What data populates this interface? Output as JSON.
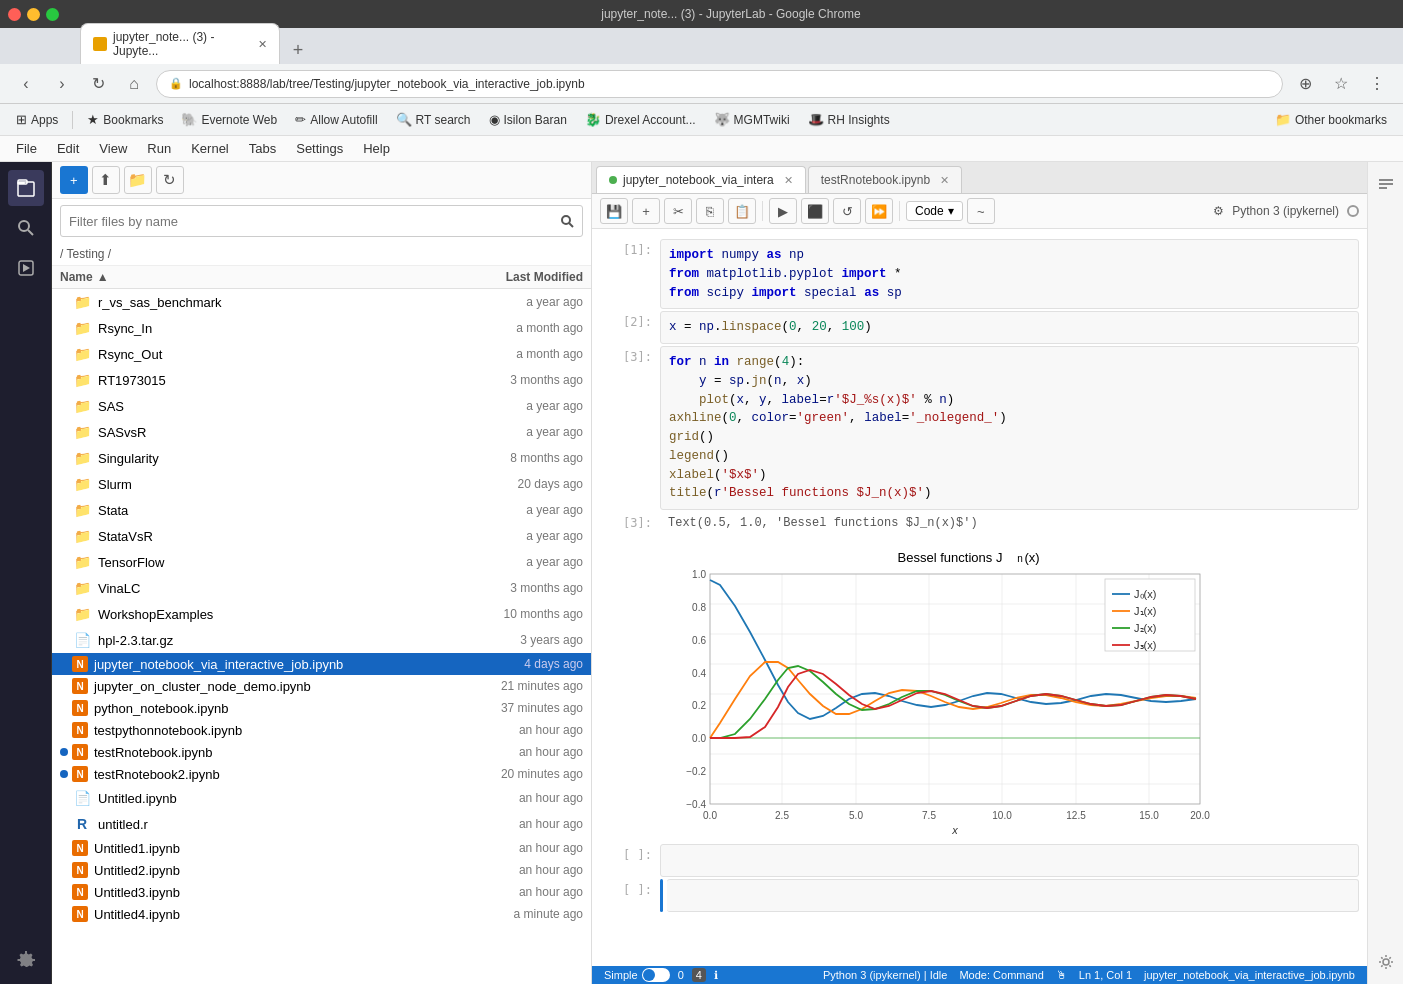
{
  "browser": {
    "title": "jupyter_note... (3) - JupyterLab - Google Chrome",
    "tab_label": "jupyter_note... (3) - Jupyte...",
    "url": "localhost:8888/lab/tree/Testing/jupyter_notebook_via_interactive_job.ipynb"
  },
  "bookmarks": {
    "items": [
      {
        "label": "Apps",
        "icon": "grid"
      },
      {
        "label": "Bookmarks",
        "icon": "star"
      },
      {
        "label": "Evernote Web",
        "icon": "evernote"
      },
      {
        "label": "Allow Autofill",
        "icon": "autofill"
      },
      {
        "label": "RT search",
        "icon": "rt"
      },
      {
        "label": "Isilon Baran",
        "icon": "isilon"
      },
      {
        "label": "Drexel Account...",
        "icon": "drexel"
      },
      {
        "label": "MGMTwiki",
        "icon": "wiki"
      },
      {
        "label": "RH Insights",
        "icon": "rh"
      },
      {
        "label": "Other bookmarks",
        "icon": "folder"
      }
    ]
  },
  "jupyterlab": {
    "menubar": [
      "File",
      "Edit",
      "View",
      "Run",
      "Kernel",
      "Tabs",
      "Settings",
      "Help"
    ],
    "sidebar_icons": [
      "files",
      "search",
      "running",
      "extensions"
    ],
    "file_browser": {
      "toolbar": {
        "new_btn": "+",
        "upload_btn": "↑",
        "refresh_btn": "↻"
      },
      "search_placeholder": "Filter files by name",
      "breadcrumb": "/ Testing /",
      "columns": [
        "Name",
        "Last Modified"
      ],
      "files": [
        {
          "type": "folder",
          "name": "r_vs_sas_benchmark",
          "modified": "a year ago",
          "dot": false
        },
        {
          "type": "folder",
          "name": "Rsync_In",
          "modified": "a month ago",
          "dot": false
        },
        {
          "type": "folder",
          "name": "Rsync_Out",
          "modified": "a month ago",
          "dot": false
        },
        {
          "type": "folder",
          "name": "RT1973015",
          "modified": "3 months ago",
          "dot": false
        },
        {
          "type": "folder",
          "name": "SAS",
          "modified": "a year ago",
          "dot": false
        },
        {
          "type": "folder",
          "name": "SASvsR",
          "modified": "a year ago",
          "dot": false
        },
        {
          "type": "folder",
          "name": "Singularity",
          "modified": "8 months ago",
          "dot": false
        },
        {
          "type": "folder",
          "name": "Slurm",
          "modified": "20 days ago",
          "dot": false
        },
        {
          "type": "folder",
          "name": "Stata",
          "modified": "a year ago",
          "dot": false
        },
        {
          "type": "folder",
          "name": "StataVsR",
          "modified": "a year ago",
          "dot": false
        },
        {
          "type": "folder",
          "name": "TensorFlow",
          "modified": "a year ago",
          "dot": false
        },
        {
          "type": "folder",
          "name": "VinaLC",
          "modified": "3 months ago",
          "dot": false
        },
        {
          "type": "folder",
          "name": "WorkshopExamples",
          "modified": "10 months ago",
          "dot": false
        },
        {
          "type": "file",
          "name": "hpl-2.3.tar.gz",
          "modified": "3 years ago",
          "dot": false
        },
        {
          "type": "notebook",
          "name": "jupyter_notebook_via_interactive_job.ipynb",
          "modified": "4 days ago",
          "dot": false,
          "selected": true
        },
        {
          "type": "notebook",
          "name": "jupyter_on_cluster_node_demo.ipynb",
          "modified": "21 minutes ago",
          "dot": false
        },
        {
          "type": "notebook",
          "name": "python_notebook.ipynb",
          "modified": "37 minutes ago",
          "dot": false
        },
        {
          "type": "notebook",
          "name": "testpythonnotebook.ipynb",
          "modified": "an hour ago",
          "dot": false
        },
        {
          "type": "notebook",
          "name": "testRnotebook.ipynb",
          "modified": "an hour ago",
          "dot": true
        },
        {
          "type": "notebook",
          "name": "testRnotebook2.ipynb",
          "modified": "20 minutes ago",
          "dot": true
        },
        {
          "type": "file",
          "name": "Untitled.ipynb",
          "modified": "an hour ago",
          "dot": false
        },
        {
          "type": "r",
          "name": "untitled.r",
          "modified": "an hour ago",
          "dot": false
        },
        {
          "type": "notebook",
          "name": "Untitled1.ipynb",
          "modified": "an hour ago",
          "dot": false
        },
        {
          "type": "notebook",
          "name": "Untitled2.ipynb",
          "modified": "an hour ago",
          "dot": false
        },
        {
          "type": "notebook",
          "name": "Untitled3.ipynb",
          "modified": "an hour ago",
          "dot": false
        },
        {
          "type": "notebook",
          "name": "Untitled4.ipynb",
          "modified": "a minute ago",
          "dot": false
        }
      ]
    },
    "notebook": {
      "tabs": [
        {
          "label": "jupyter_notebook_via_intera",
          "active": true,
          "dot": true
        },
        {
          "label": "testRnotebook.ipynb",
          "active": false,
          "dot": false
        }
      ],
      "kernel": "Python 3 (ipykernel)",
      "cell_type": "Code",
      "cells": [
        {
          "id": "[1]:",
          "type": "input",
          "code": "import numpy as np\nfrom matplotlib.pyplot import *\nfrom scipy import special as sp"
        },
        {
          "id": "[2]:",
          "type": "input",
          "code": "x = np.linspace(0, 20, 100)"
        },
        {
          "id": "[3]:",
          "type": "input",
          "code": "for n in range(4):\n    y = sp.jn(n, x)\n    plot(x, y, label=r'$J_%s(x)$' % n)\naxhline(0, color='green', label='_nolegend_')\ngrid()\nlegend()\nxlabel('$x$')\ntitle(r'Bessel functions $J_n(x)$')"
        },
        {
          "id": "[3]:",
          "type": "output",
          "text": "Text(0.5, 1.0, 'Bessel functions $J_n(x)$')"
        }
      ],
      "chart": {
        "title": "Bessel functions J_n(x)",
        "xlabel": "x",
        "legend": [
          "J₀(x)",
          "J₁(x)",
          "J₂(x)",
          "J₃(x)"
        ],
        "legend_colors": [
          "#1f77b4",
          "#ff7f0e",
          "#2ca02c",
          "#d62728"
        ],
        "y_range": [
          -0.4,
          1.0
        ],
        "x_range": [
          0,
          20
        ]
      }
    },
    "statusbar": {
      "mode": "Simple",
      "conda_env": "0",
      "kernel": "Python 3 (ipykernel) | Idle",
      "mode_cmd": "Mode: Command",
      "position": "Ln 1, Col 1",
      "filename": "jupyter_notebook_via_interactive_job.ipynb"
    }
  }
}
